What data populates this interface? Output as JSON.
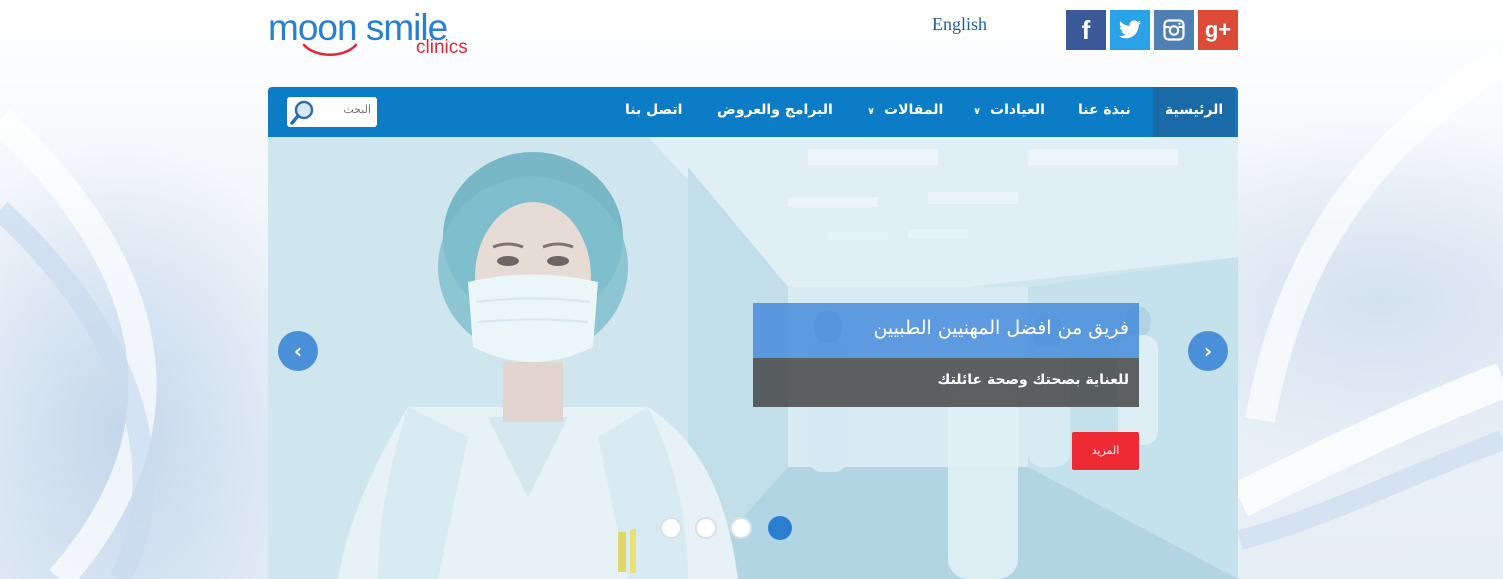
{
  "header": {
    "logo": {
      "line1": "moon smile",
      "line2": "clinics"
    },
    "language_link": "English",
    "social": [
      {
        "icon": "facebook-icon",
        "label": "f"
      },
      {
        "icon": "twitter-icon",
        "label": ""
      },
      {
        "icon": "instagram-icon",
        "label": ""
      },
      {
        "icon": "google-plus-icon",
        "label": "g+"
      }
    ]
  },
  "nav": {
    "items": [
      {
        "label": "الرئيسية",
        "active": true
      },
      {
        "label": "نبذة عنا"
      },
      {
        "label": "العيادات",
        "dropdown": true
      },
      {
        "label": "المقالات",
        "dropdown": true
      },
      {
        "label": "البرامج والعروض"
      },
      {
        "label": "اتصل بنا"
      }
    ],
    "search_placeholder": "البحث"
  },
  "slider": {
    "caption_title": "فريق من افضل المهنيين الطبيين",
    "caption_subtitle": "للعناية بصحتك وصحة عائلتك",
    "more_button": "المزيد",
    "slide_count": 4,
    "active_slide": 4
  },
  "colors": {
    "nav_bg": "#0b7cc5",
    "nav_active": "#1a6aa8",
    "accent_red": "#ee2a35",
    "caption_blue": "#468cdc",
    "brand_blue": "#2a7fd0",
    "brand_red": "#e0283a"
  }
}
